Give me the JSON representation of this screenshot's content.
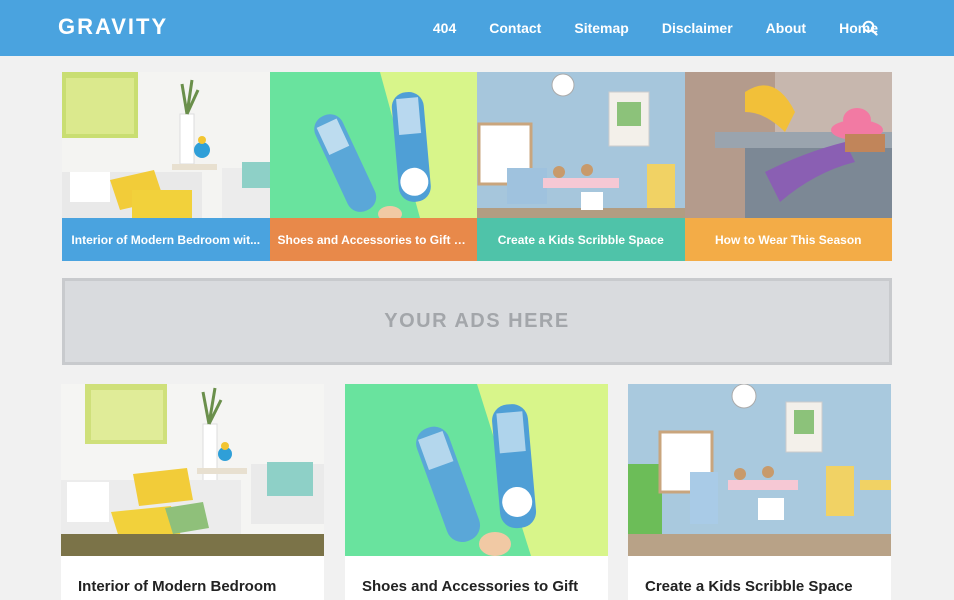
{
  "header": {
    "logo": "GRAVITY",
    "nav": [
      "404",
      "Contact",
      "Sitemap",
      "Disclaimer",
      "About",
      "Home"
    ],
    "search_icon": "search-icon"
  },
  "featured": [
    {
      "title": "Interior of Modern Bedroom wit...",
      "color": "#4aa3df"
    },
    {
      "title": "Shoes and Accessories to Gift a...",
      "color": "#e8894a"
    },
    {
      "title": "Create a Kids Scribble Space",
      "color": "#4fc3a9"
    },
    {
      "title": "How to Wear This Season",
      "color": "#f3ac47"
    }
  ],
  "ads": {
    "text": "YOUR ADS HERE"
  },
  "posts": [
    {
      "title": "Interior of Modern Bedroom with Bed"
    },
    {
      "title": "Shoes and Accessories to Gift and Get"
    },
    {
      "title": "Create a Kids Scribble Space"
    }
  ]
}
